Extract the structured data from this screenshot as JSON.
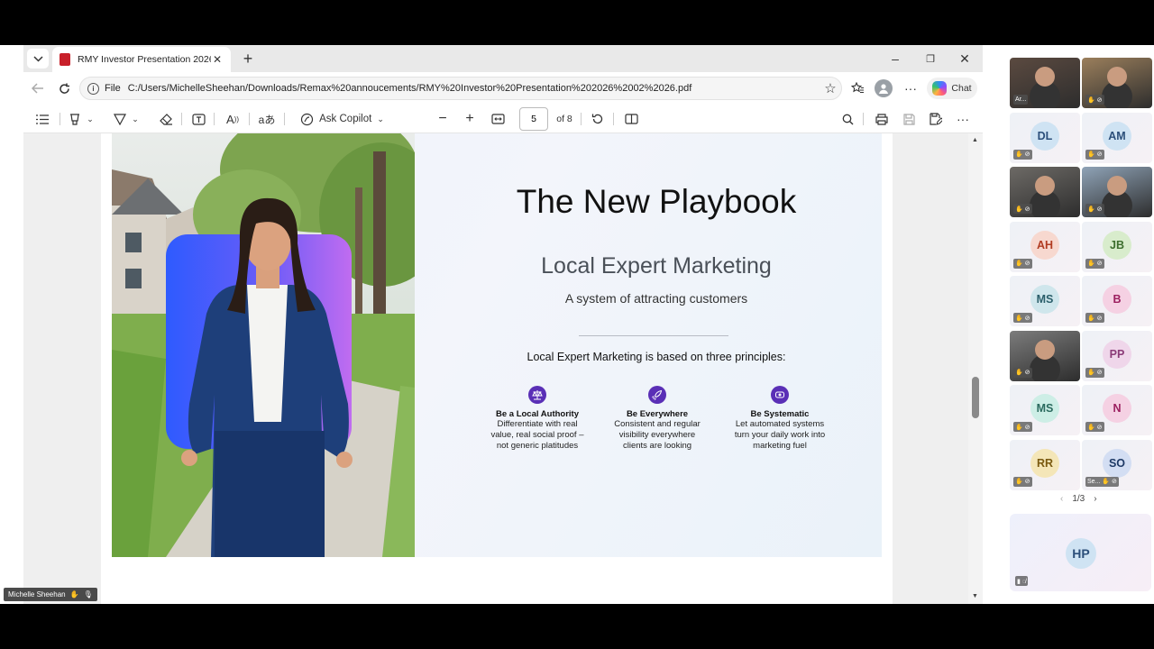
{
  "tab": {
    "title": "RMY Investor Presentation 2026 0..."
  },
  "address": {
    "file_label": "File",
    "url": "C:/Users/MichelleSheehan/Downloads/Remax%20annoucements/RMY%20Investor%20Presentation%202026%2002%2026.pdf"
  },
  "browser_actions": {
    "chat_label": "Chat"
  },
  "pdf_toolbar": {
    "ask_copilot": "Ask Copilot",
    "page_number": "5",
    "page_total": "of 8"
  },
  "slide": {
    "title": "The New Playbook",
    "subtitle": "Local Expert Marketing",
    "tagline": "A system of attracting customers",
    "principles_heading": "Local Expert Marketing is based on three principles:",
    "principles": [
      {
        "icon": "scale-icon",
        "title": "Be a Local Authority",
        "line1": "Differentiate with real",
        "line2": "value, real social proof –",
        "line3": "not generic platitudes"
      },
      {
        "icon": "rocket-icon",
        "title": "Be Everywhere",
        "line1": "Consistent and regular",
        "line2": "visibility everywhere",
        "line3": "clients are looking"
      },
      {
        "icon": "automation-icon",
        "title": "Be Systematic",
        "line1": "Let automated systems",
        "line2": "turn your daily work into",
        "line3": "marketing fuel"
      }
    ]
  },
  "participants": {
    "tiles": [
      {
        "kind": "video",
        "name": "Ar..."
      },
      {
        "kind": "video",
        "name": ""
      },
      {
        "kind": "avatar",
        "initials": "DL",
        "color": "#2c4f7a",
        "bg": "#cfe3f3"
      },
      {
        "kind": "avatar",
        "initials": "AM",
        "color": "#2c4f7a",
        "bg": "#cfe3f3"
      },
      {
        "kind": "video",
        "name": ""
      },
      {
        "kind": "video",
        "name": ""
      },
      {
        "kind": "avatar",
        "initials": "AH",
        "color": "#b13c22",
        "bg": "#f7d8cf"
      },
      {
        "kind": "avatar",
        "initials": "JB",
        "color": "#3d6e2e",
        "bg": "#d8eccc"
      },
      {
        "kind": "avatar",
        "initials": "MS",
        "color": "#2b5f6b",
        "bg": "#cfe6ec"
      },
      {
        "kind": "avatar",
        "initials": "B",
        "color": "#9c2060",
        "bg": "#f5d1e3"
      },
      {
        "kind": "video",
        "name": ""
      },
      {
        "kind": "avatar",
        "initials": "PP",
        "color": "#8b3b78",
        "bg": "#efd6ea"
      },
      {
        "kind": "avatar",
        "initials": "MS",
        "color": "#2b6b5f",
        "bg": "#cdeee6"
      },
      {
        "kind": "avatar",
        "initials": "N",
        "color": "#9c2060",
        "bg": "#f5d1e3"
      },
      {
        "kind": "avatar",
        "initials": "RR",
        "color": "#7a5a10",
        "bg": "#f4e6b8"
      },
      {
        "kind": "avatar",
        "initials": "SO",
        "color": "#1e3a66",
        "bg": "#d3def3",
        "name": "Se..."
      }
    ],
    "pagination": "1/3",
    "featured": {
      "initials": "HP",
      "color": "#2c4f7a",
      "bg": "#cfe3f3"
    }
  },
  "self_view": {
    "name": "Michelle Sheehan"
  }
}
